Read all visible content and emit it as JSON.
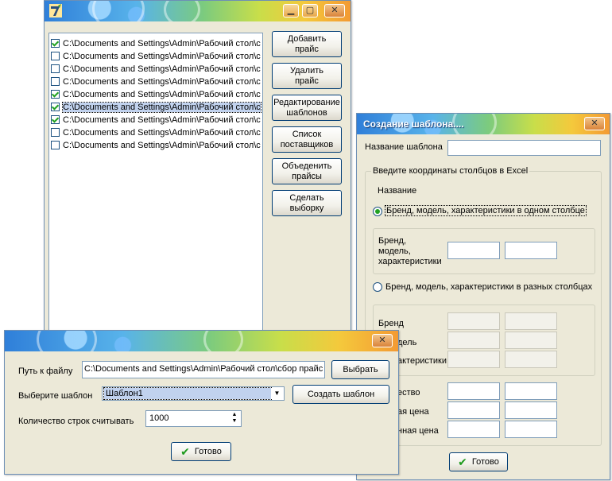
{
  "main": {
    "items": [
      {
        "path": "C:\\Documents and Settings\\Admin\\Рабочий стол\\с",
        "checked": true
      },
      {
        "path": "C:\\Documents and Settings\\Admin\\Рабочий стол\\с",
        "checked": false
      },
      {
        "path": "C:\\Documents and Settings\\Admin\\Рабочий стол\\с",
        "checked": false
      },
      {
        "path": "C:\\Documents and Settings\\Admin\\Рабочий стол\\с",
        "checked": false
      },
      {
        "path": "C:\\Documents and Settings\\Admin\\Рабочий стол\\с",
        "checked": true
      },
      {
        "path": "C:\\Documents and Settings\\Admin\\Рабочий стол\\с",
        "checked": true,
        "selected": true
      },
      {
        "path": "C:\\Documents and Settings\\Admin\\Рабочий стол\\с",
        "checked": true
      },
      {
        "path": "C:\\Documents and Settings\\Admin\\Рабочий стол\\с",
        "checked": false
      },
      {
        "path": "C:\\Documents and Settings\\Admin\\Рабочий стол\\с",
        "checked": false
      }
    ],
    "buttons": {
      "add_price": [
        "Добавить",
        "прайс"
      ],
      "delete_price": [
        "Удалить",
        "прайс"
      ],
      "edit_templates": [
        "Редактирование",
        "шаблонов"
      ],
      "suppliers": [
        "Список",
        "поставщиков"
      ],
      "merge_prices": [
        "Объеденить",
        "прайсы"
      ],
      "make_selection": [
        "Сделать",
        "выборку"
      ]
    }
  },
  "template": {
    "title": "Создание шаблона....",
    "name_label": "Название шаблона",
    "name_value": "",
    "coords_group": "Введите координаты столбцов в Excel",
    "name_section": "Название",
    "radio_single": "Бренд, модель, характеристики в одном столбце",
    "radio_single_checked": true,
    "single_label": [
      "Бренд,",
      "модель,",
      "характеристики"
    ],
    "radio_multi": "Бренд, модель, характеристики в разных столбцах",
    "radio_multi_checked": false,
    "brand_label": "Бренд",
    "model_label_partial": "дель",
    "chars_label_partial": "актеристики",
    "qty_label_partial": "ество",
    "price_label_partial": "ая цена",
    "price2_label_partial": "нная цена",
    "ok_label": "Готово"
  },
  "load": {
    "path_label": "Путь к файлу",
    "path_value": "C:\\Documents and Settings\\Admin\\Рабочий стол\\сбор прайс",
    "browse_label": "Выбрать",
    "template_label": "Выберите шаблон",
    "template_value": "Шаблон1",
    "create_label": "Создать шаблон",
    "rows_label": "Количество строк считывать",
    "rows_value": "1000",
    "ok_label": "Готово"
  },
  "icons": {
    "window_controls": [
      "minimize-icon",
      "maximize-icon",
      "close-icon"
    ]
  }
}
